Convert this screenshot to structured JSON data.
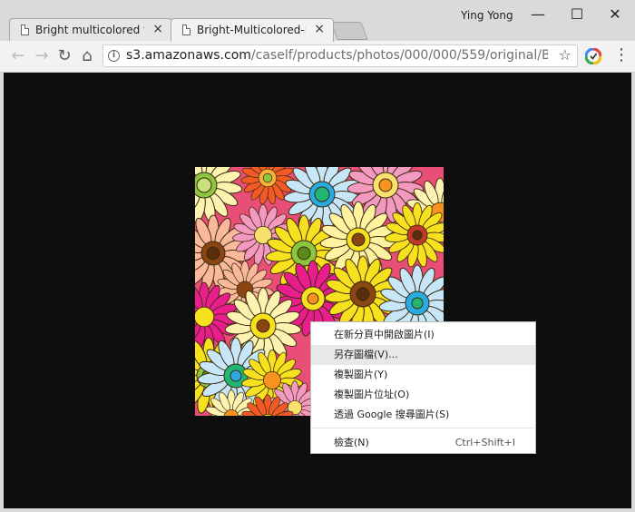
{
  "tabs": [
    {
      "title": "Bright multicolored flor",
      "close": "×"
    },
    {
      "title": "Bright-Multicolored-Flo",
      "close": "×"
    }
  ],
  "user": {
    "name": "Ying Yong"
  },
  "window_controls": {
    "minimize": "—",
    "maximize": "☐",
    "close": "✕"
  },
  "toolbar": {
    "back": "←",
    "forward": "→",
    "reload": "↻",
    "home": "⌂",
    "star": "☆",
    "menu": "⋮"
  },
  "address": {
    "host": "s3.amazonaws.com",
    "path": "/caself/products/photos/000/000/559/original/Bright-M..."
  },
  "context_menu": {
    "items": [
      {
        "label": "在新分頁中開啟圖片(I)",
        "shortcut": ""
      },
      {
        "label": "另存圖檔(V)...",
        "shortcut": ""
      },
      {
        "label": "複製圖片(Y)",
        "shortcut": ""
      },
      {
        "label": "複製圖片位址(O)",
        "shortcut": ""
      },
      {
        "label": "透過 Google 搜尋圖片(S)",
        "shortcut": ""
      },
      {
        "label": "檢查(N)",
        "shortcut": "Ctrl+Shift+I"
      }
    ],
    "highlighted_index": 1
  },
  "colors": {
    "viewport_bg": "#0e0e0e",
    "frame": "#dadada",
    "menu_hover": "#e8e8e8"
  }
}
